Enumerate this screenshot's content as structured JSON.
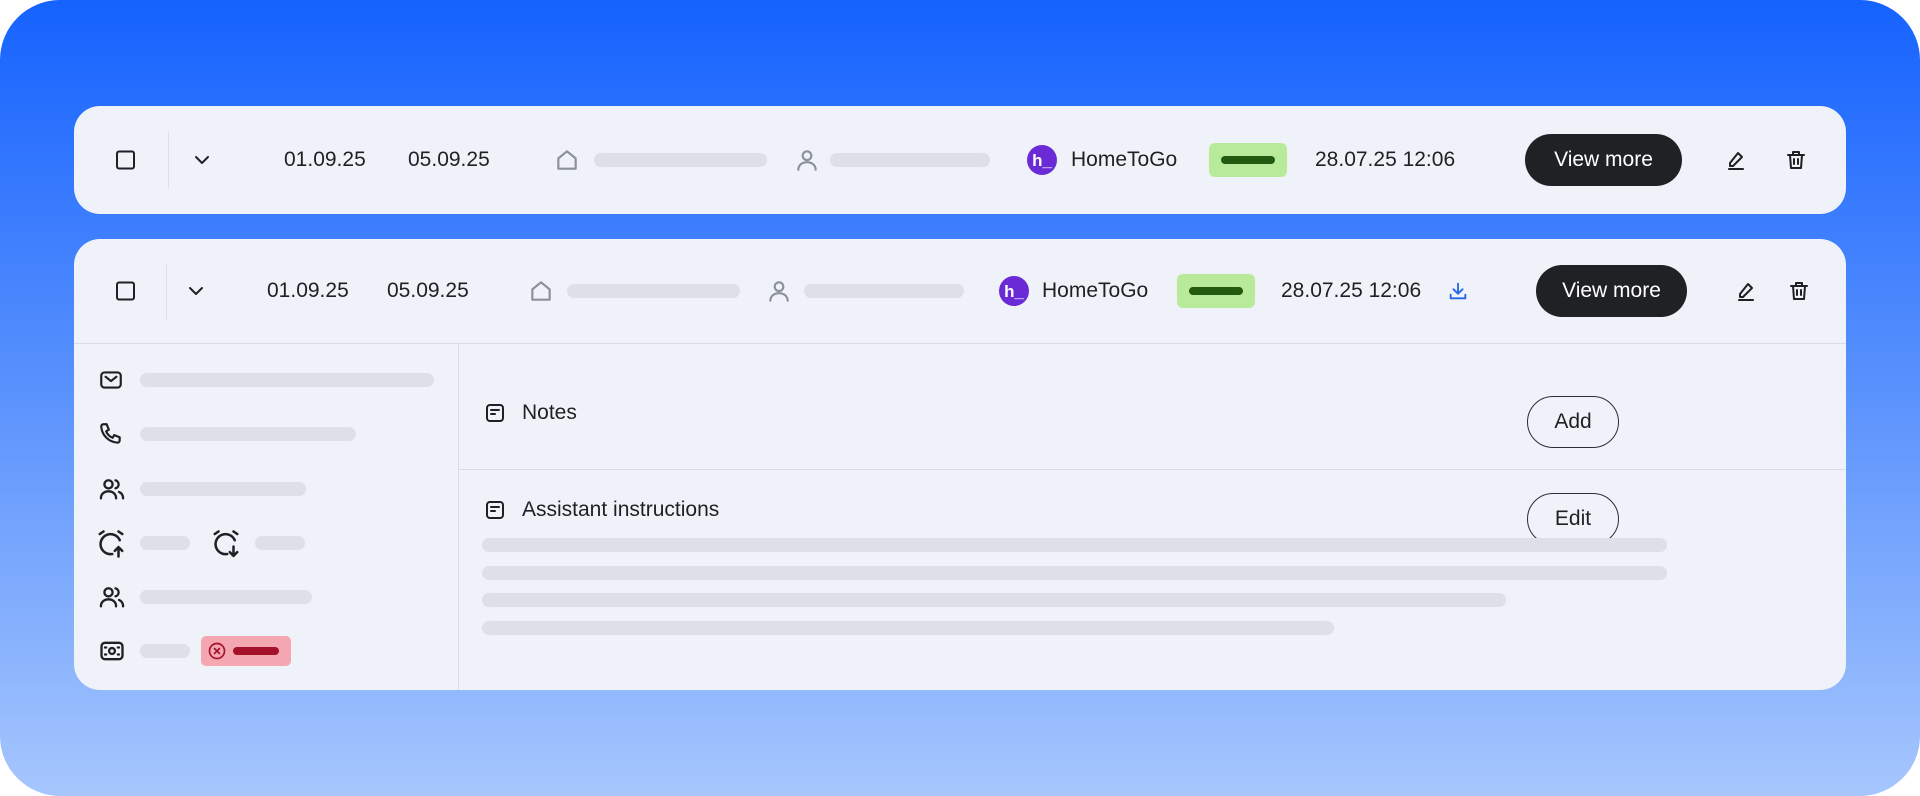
{
  "colors": {
    "background_top": "#1562fe",
    "background_bottom": "#a6c6fd",
    "card": "#eff3f9",
    "dark_button": "#1f2125",
    "status_green": "#b9ea9a",
    "status_green_bar": "#245a10",
    "status_red": "#f4a7b0",
    "status_red_bar": "#a5112a",
    "logo_purple": "#6a2bd6",
    "download_blue": "#2366e6"
  },
  "rows": [
    {
      "checkin": "01.09.25",
      "checkout": "05.09.25",
      "channel_logo_text": "h_",
      "channel": "HomeToGo",
      "created": "28.07.25 12:06",
      "view_more_label": "View more",
      "icons": [
        "checkbox",
        "chevron-down-icon",
        "house-icon",
        "user-icon",
        "edit-icon",
        "trash-icon"
      ]
    },
    {
      "checkin": "01.09.25",
      "checkout": "05.09.25",
      "channel_logo_text": "h_",
      "channel": "HomeToGo",
      "created": "28.07.25 12:06",
      "view_more_label": "View more",
      "icons": [
        "checkbox",
        "chevron-down-icon",
        "house-icon",
        "user-icon",
        "download-icon",
        "edit-icon",
        "trash-icon"
      ]
    }
  ],
  "details": {
    "left_icons": [
      "mail-icon",
      "phone-icon",
      "guests-icon",
      "alarm-arrive-icon",
      "alarm-leave-icon",
      "guests-icon",
      "money-icon",
      "cancel-circle-icon"
    ],
    "notes": {
      "title": "Notes",
      "button_label": "Add"
    },
    "assistant": {
      "title": "Assistant instructions",
      "button_label": "Edit"
    }
  }
}
